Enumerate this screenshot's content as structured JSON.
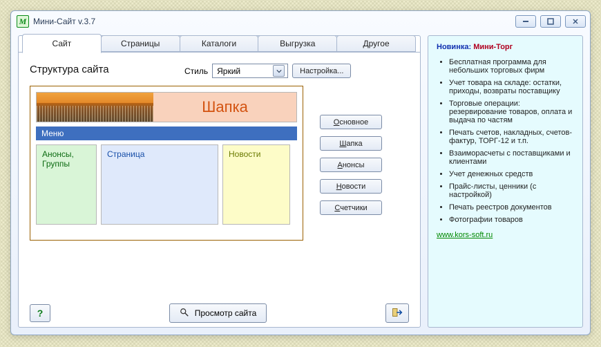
{
  "window": {
    "title": "Мини-Сайт v.3.7"
  },
  "tabs": {
    "t0": "Сайт",
    "t1": "Страницы",
    "t2": "Каталоги",
    "t3": "Выгрузка",
    "t4": "Другое"
  },
  "section_title": "Структура сайта",
  "style": {
    "label": "Стиль",
    "selected": "Яркий",
    "settings_btn": "Настройка..."
  },
  "preview": {
    "header_label": "Шапка",
    "menu_label": "Меню",
    "anons_label": "Анонсы, Группы",
    "page_label": "Страница",
    "news_label": "Новости"
  },
  "side_buttons": {
    "main": "сновное",
    "header": "апка",
    "anons": "нонсы",
    "news": "овости",
    "counters": "четчики",
    "accel": {
      "main": "О",
      "header": "Ш",
      "anons": "А",
      "news": "Н",
      "counters": "С"
    }
  },
  "bottom": {
    "help": "?",
    "preview": "Просмотр сайта"
  },
  "info": {
    "headline_label": "Новинка: ",
    "product": "Мини-Торг",
    "items": {
      "i0": "Бесплатная программа для небольших торговых фирм",
      "i1": "Учет товара на складе: остатки, приходы, возвраты поставщику",
      "i2": "Торговые операции: резервирование товаров, оплата и выдача по частям",
      "i3": "Печать счетов, накладных, счетов-фактур, ТОРГ-12 и т.п.",
      "i4": "Взаиморасчеты с поставщиками и клиентами",
      "i5": "Учет денежных средств",
      "i6": "Прайс-листы, ценники (с настройкой)",
      "i7": "Печать реестров документов",
      "i8": "Фотографии товаров"
    },
    "link": "www.kors-soft.ru"
  }
}
